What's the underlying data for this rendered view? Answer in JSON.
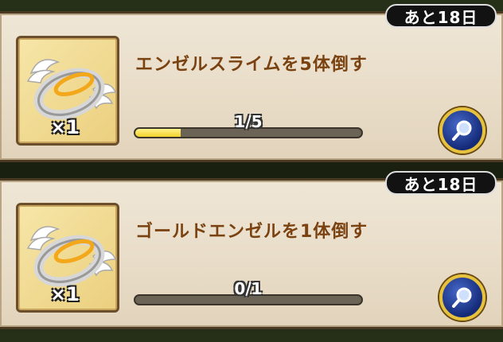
{
  "quests": [
    {
      "days_left": "あと18日",
      "title": "エンゼルスライムを5体倒す",
      "reward_qty": "×1",
      "reward_icon": "angel-ring-icon",
      "progress_text": "1/5",
      "progress_fraction": 0.2
    },
    {
      "days_left": "あと18日",
      "title": "ゴールドエンゼルを1体倒す",
      "reward_qty": "×1",
      "reward_icon": "angel-ring-icon",
      "progress_text": "0/1",
      "progress_fraction": 0.0
    }
  ],
  "colors": {
    "title": "#7a4210",
    "progress_fill": "#f2d12a",
    "search_button": "#142a78",
    "search_ring": "#e6c23c"
  }
}
